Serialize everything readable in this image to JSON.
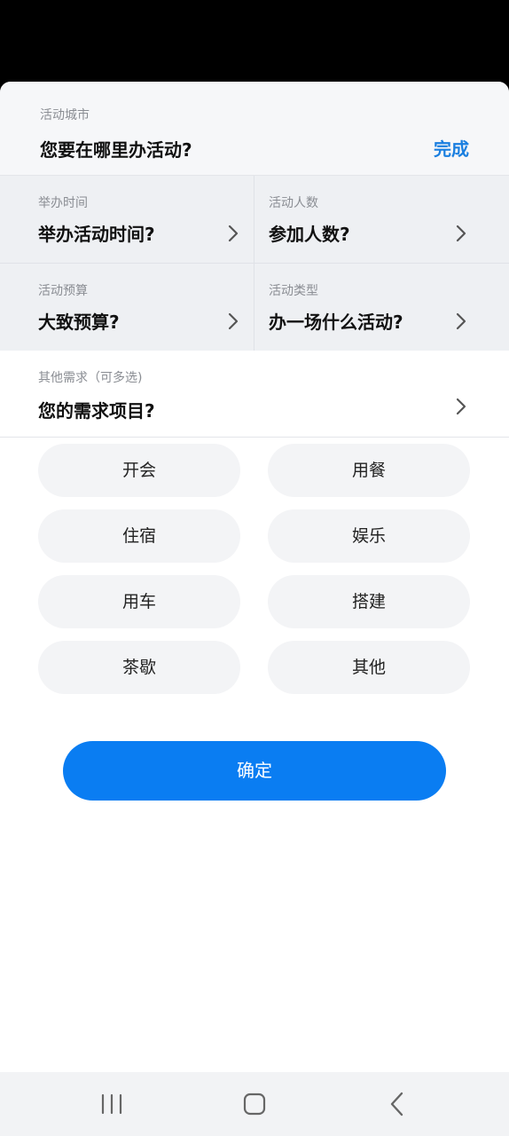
{
  "city": {
    "label": "活动城市",
    "prompt": "您要在哪里办活动?",
    "done_label": "完成"
  },
  "fields": [
    {
      "label": "举办时间",
      "prompt": "举办活动时间?"
    },
    {
      "label": "活动人数",
      "prompt": "参加人数?"
    },
    {
      "label": "活动预算",
      "prompt": "大致预算?"
    },
    {
      "label": "活动类型",
      "prompt": "办一场什么活动?"
    }
  ],
  "needs": {
    "label": "其他需求（可多选)",
    "prompt": "您的需求项目?",
    "options": [
      "开会",
      "用餐",
      "住宿",
      "娱乐",
      "用车",
      "搭建",
      "茶歇",
      "其他"
    ]
  },
  "confirm_label": "确定",
  "nav": {
    "icons": [
      "recent-apps-icon",
      "home-icon",
      "back-icon"
    ]
  },
  "colors": {
    "accent": "#0a7df2",
    "done_text": "#1a7fe0"
  }
}
